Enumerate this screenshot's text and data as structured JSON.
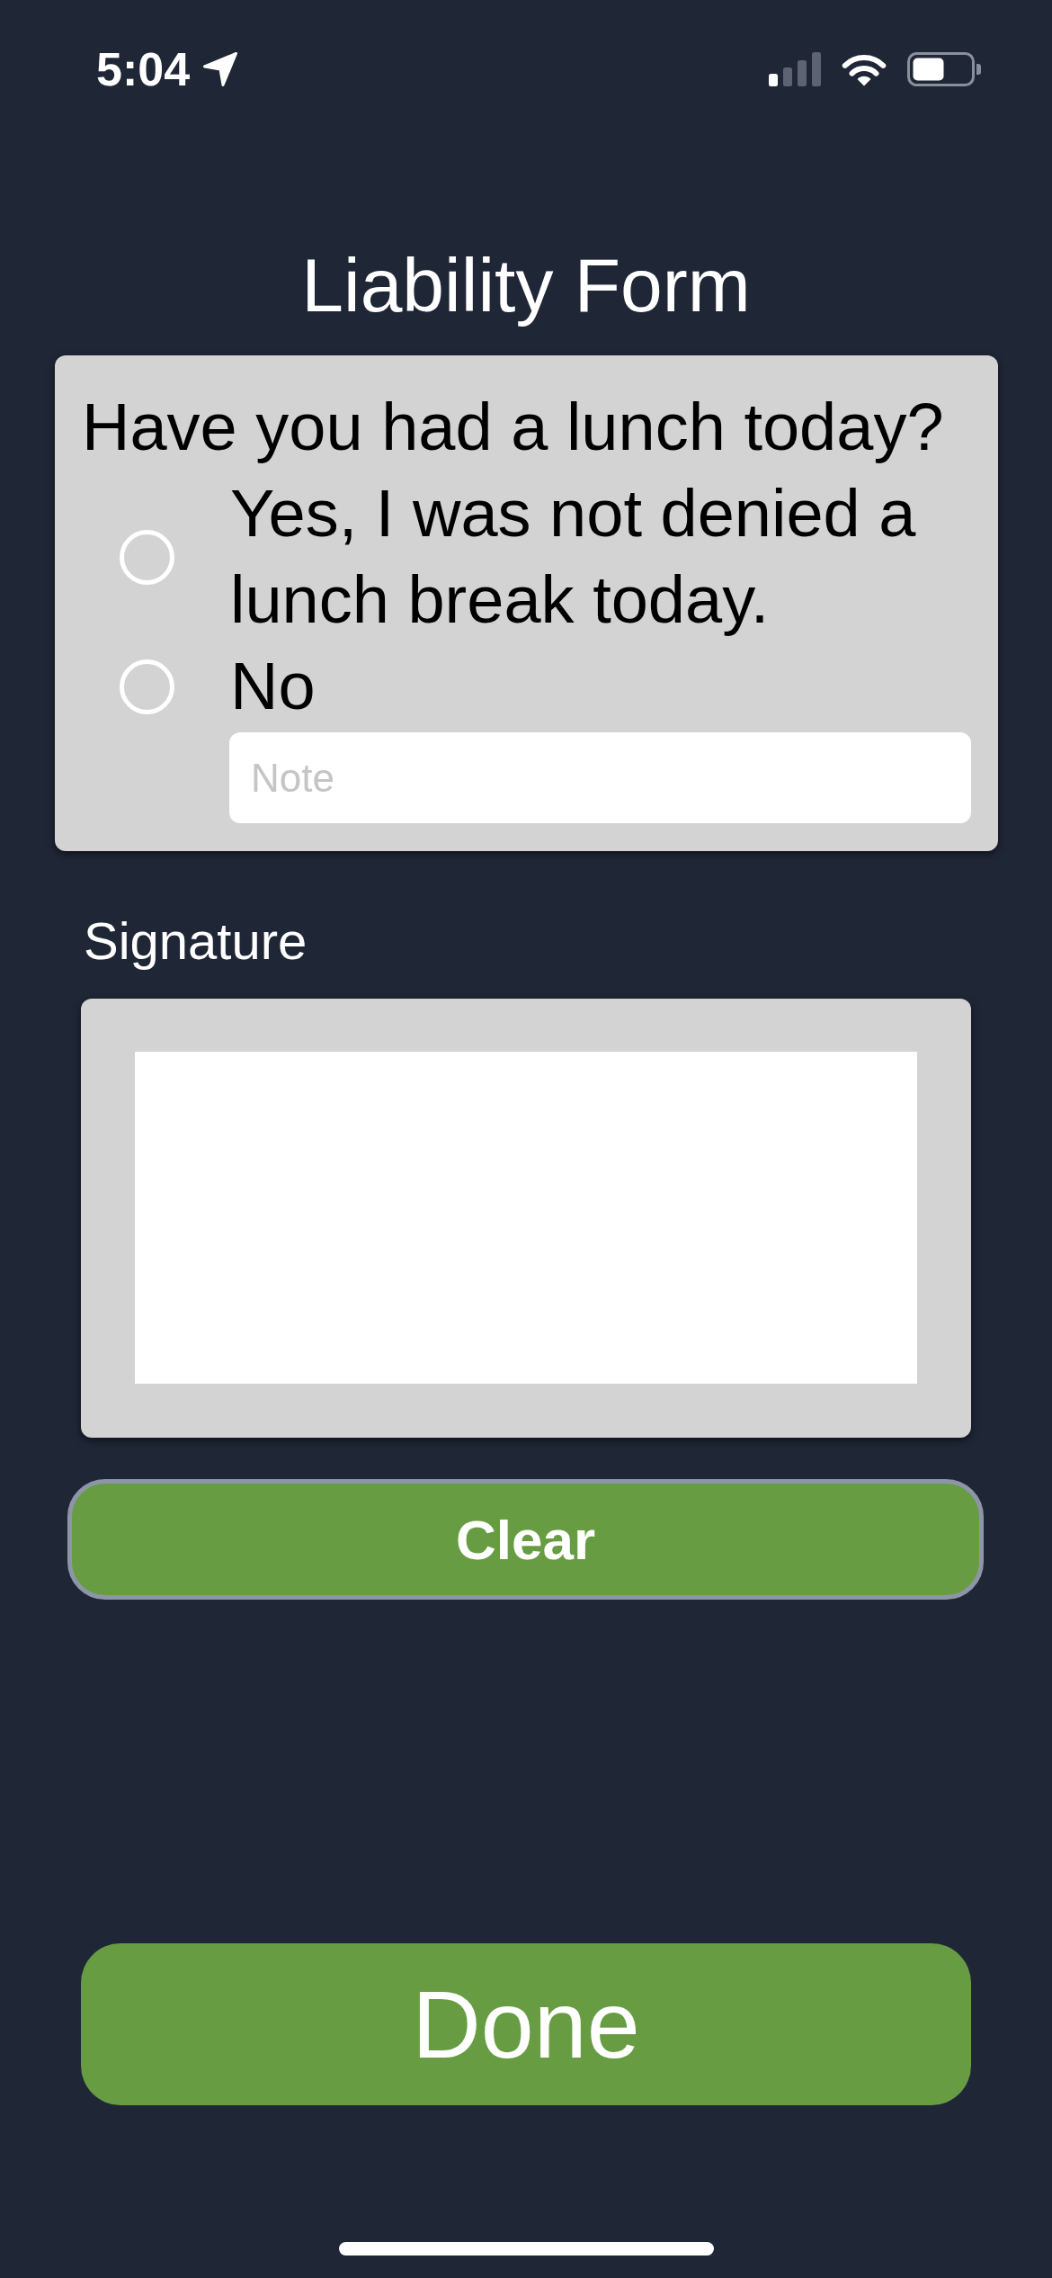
{
  "status_bar": {
    "time": "5:04"
  },
  "title": "Liability Form",
  "question": {
    "prompt": "Have you had a lunch today?",
    "options": [
      {
        "label": "Yes, I was not denied a lunch break today.",
        "selected": false
      },
      {
        "label": "No",
        "selected": false
      }
    ],
    "note": {
      "placeholder": "Note"
    }
  },
  "signature": {
    "label": "Signature",
    "clear_button": {
      "label": "Clear"
    }
  },
  "done_button": {
    "label": "Done"
  }
}
